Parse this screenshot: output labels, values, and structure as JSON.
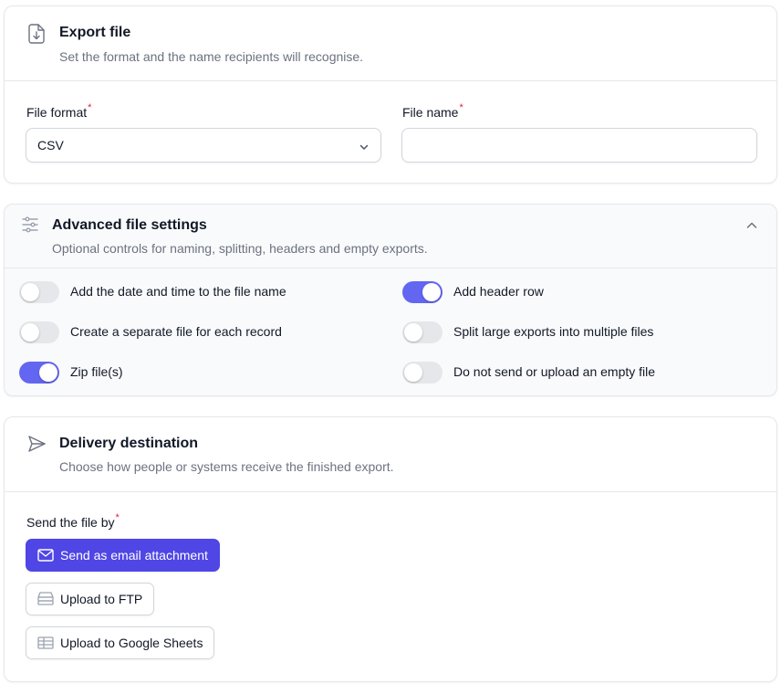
{
  "export": {
    "title": "Export file",
    "subtitle": "Set the format and the name recipients will recognise.",
    "format_label": "File format",
    "format_value": "CSV",
    "name_label": "File name",
    "name_value": "",
    "required_mark": "*"
  },
  "advanced": {
    "title": "Advanced file settings",
    "subtitle": "Optional controls for naming, splitting, headers and empty exports.",
    "toggles": [
      {
        "label": "Add the date and time to the file name",
        "on": false
      },
      {
        "label": "Add header row",
        "on": true
      },
      {
        "label": "Create a separate file for each record",
        "on": false
      },
      {
        "label": "Split large exports into multiple files",
        "on": false
      },
      {
        "label": "Zip file(s)",
        "on": true
      },
      {
        "label": "Do not send or upload an empty file",
        "on": false
      }
    ]
  },
  "delivery": {
    "title": "Delivery destination",
    "subtitle": "Choose how people or systems receive the finished export.",
    "send_label": "Send the file by",
    "options": [
      {
        "label": "Send as email attachment",
        "icon": "mail-icon",
        "selected": true
      },
      {
        "label": "Upload to FTP",
        "icon": "server-icon",
        "selected": false
      },
      {
        "label": "Upload to Google Sheets",
        "icon": "table-icon",
        "selected": false
      }
    ]
  },
  "colors": {
    "accent": "#4f46e5",
    "toggle_on": "#6366f1",
    "required": "#e11d48"
  }
}
